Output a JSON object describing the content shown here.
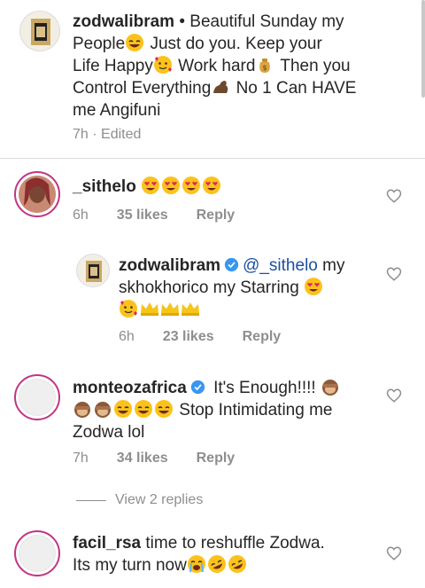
{
  "caption": {
    "username": "zodwalibram",
    "text_1": " • Beautiful Sunday my",
    "text_2": "People",
    "text_3": " Just do you. Keep your",
    "text_4": "Life Happy",
    "text_5": " Work hard",
    "text_6": " Then you",
    "text_7": "Control Everything",
    "text_8": " No 1 Can HAVE",
    "text_9": "me Angifuni",
    "time": "7h",
    "edited": "Edited"
  },
  "comments": [
    {
      "username": "_sithelo",
      "time": "6h",
      "likes": "35 likes",
      "reply": "Reply"
    },
    {
      "username": "zodwalibram",
      "mention": "@_sithelo",
      "text_1": " my",
      "text_2": "skhokhorico my Starring ",
      "time": "6h",
      "likes": "23 likes",
      "reply": "Reply"
    },
    {
      "username": "monteozafrica",
      "text_1": " It's Enough!!!! ",
      "text_2": " Stop Intimidating me",
      "text_3": "Zodwa lol",
      "time": "7h",
      "likes": "34 likes",
      "reply": "Reply"
    },
    {
      "username": "facil_rsa",
      "text_1": " time to reshuffle Zodwa.",
      "text_2": "Its my turn now"
    }
  ],
  "view_replies": "View 2 replies",
  "colors": {
    "text": "#262626",
    "muted": "#8e8e8e",
    "verified": "#3897f0",
    "divider": "#dbdbdb",
    "story_ring": "#c13584"
  },
  "icons": [
    "heart-outline-icon",
    "verified-badge-icon"
  ]
}
